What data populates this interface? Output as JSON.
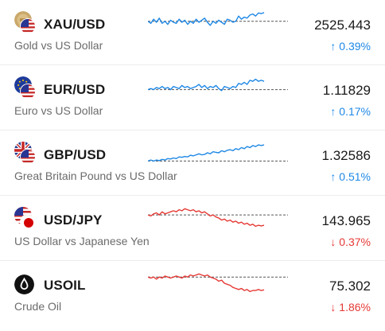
{
  "colors": {
    "up": "#1e88e5",
    "down": "#e53935",
    "baseline": "#555555"
  },
  "rows": [
    {
      "symbol": "XAU/USD",
      "description": "Gold vs US Dollar",
      "price": "2525.443",
      "change": "↑ 0.39%",
      "direction": "up",
      "icons": [
        "gold-coin-icon",
        "us-flag-icon"
      ],
      "spark": [
        0.45,
        0.55,
        0.35,
        0.5,
        0.3,
        0.55,
        0.45,
        0.6,
        0.4,
        0.5,
        0.55,
        0.35,
        0.5,
        0.4,
        0.6,
        0.45,
        0.55,
        0.35,
        0.5,
        0.4,
        0.3,
        0.5,
        0.65,
        0.45,
        0.55,
        0.4,
        0.5,
        0.6,
        0.35,
        0.4,
        0.5,
        0.45,
        0.2,
        0.35,
        0.25,
        0.3,
        0.15,
        0.1,
        0.2,
        0.05,
        0.08,
        0.03
      ]
    },
    {
      "symbol": "EUR/USD",
      "description": "Euro vs US Dollar",
      "price": "1.11829",
      "change": "↑ 0.17%",
      "direction": "up",
      "icons": [
        "eu-flag-icon",
        "us-flag-icon"
      ],
      "spark": [
        0.6,
        0.55,
        0.6,
        0.5,
        0.55,
        0.45,
        0.55,
        0.5,
        0.6,
        0.45,
        0.5,
        0.55,
        0.4,
        0.5,
        0.45,
        0.55,
        0.5,
        0.45,
        0.35,
        0.5,
        0.4,
        0.55,
        0.45,
        0.5,
        0.4,
        0.55,
        0.65,
        0.45,
        0.5,
        0.55,
        0.45,
        0.5,
        0.3,
        0.35,
        0.25,
        0.35,
        0.15,
        0.2,
        0.1,
        0.2,
        0.15,
        0.2
      ]
    },
    {
      "symbol": "GBP/USD",
      "description": "Great Britain Pound vs US Dollar",
      "price": "1.32586",
      "change": "↑ 0.51%",
      "direction": "up",
      "icons": [
        "uk-flag-icon",
        "us-flag-icon"
      ],
      "spark": [
        0.9,
        0.85,
        0.9,
        0.85,
        0.88,
        0.82,
        0.85,
        0.78,
        0.8,
        0.75,
        0.78,
        0.7,
        0.72,
        0.68,
        0.7,
        0.62,
        0.65,
        0.6,
        0.55,
        0.6,
        0.58,
        0.5,
        0.55,
        0.45,
        0.48,
        0.5,
        0.4,
        0.45,
        0.38,
        0.35,
        0.4,
        0.3,
        0.35,
        0.25,
        0.3,
        0.2,
        0.25,
        0.15,
        0.2,
        0.12,
        0.15,
        0.12
      ]
    },
    {
      "symbol": "USD/JPY",
      "description": "US Dollar vs Japanese Yen",
      "price": "143.965",
      "change": "↓ 0.37%",
      "direction": "down",
      "icons": [
        "us-flag-icon",
        "japan-flag-icon"
      ],
      "spark": [
        0.35,
        0.4,
        0.3,
        0.25,
        0.35,
        0.2,
        0.3,
        0.25,
        0.2,
        0.15,
        0.2,
        0.1,
        0.15,
        0.05,
        0.1,
        0.15,
        0.1,
        0.2,
        0.15,
        0.25,
        0.2,
        0.3,
        0.4,
        0.35,
        0.45,
        0.5,
        0.6,
        0.55,
        0.65,
        0.6,
        0.7,
        0.65,
        0.75,
        0.7,
        0.8,
        0.75,
        0.85,
        0.8,
        0.9,
        0.85,
        0.88,
        0.85
      ]
    },
    {
      "symbol": "USOIL",
      "description": "Crude Oil",
      "price": "75.302",
      "change": "↓ 1.86%",
      "direction": "down",
      "icons": [
        "oil-drop-icon"
      ],
      "spark": [
        0.2,
        0.25,
        0.2,
        0.3,
        0.2,
        0.25,
        0.15,
        0.2,
        0.25,
        0.2,
        0.15,
        0.2,
        0.25,
        0.15,
        0.2,
        0.1,
        0.15,
        0.1,
        0.05,
        0.1,
        0.15,
        0.1,
        0.2,
        0.25,
        0.3,
        0.4,
        0.35,
        0.5,
        0.55,
        0.6,
        0.7,
        0.75,
        0.8,
        0.75,
        0.85,
        0.8,
        0.9,
        0.85,
        0.85,
        0.8,
        0.85,
        0.82
      ]
    }
  ]
}
